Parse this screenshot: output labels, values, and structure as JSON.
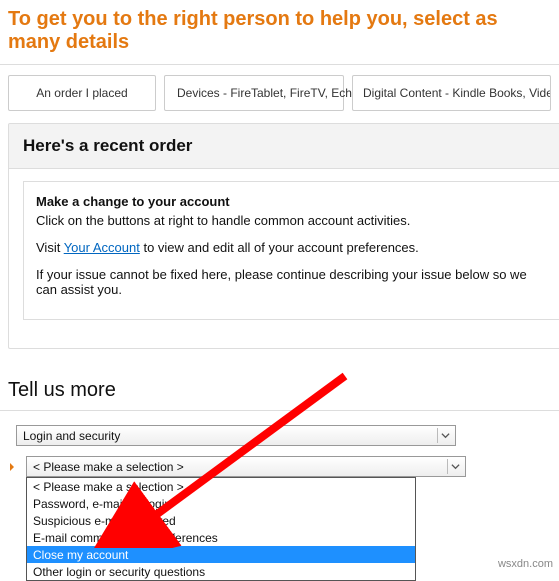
{
  "heading": "To get you to the right person to help you, select as many details",
  "tabs": [
    "An order I placed",
    "Devices - FireTablet, FireTV, Echo etc.",
    "Digital Content - Kindle Books, Videos, Music"
  ],
  "panel": {
    "title": "Here's a recent order",
    "box_title": "Make a change to your account",
    "line1": "Click on the buttons at right to handle common account activities.",
    "line2_pre": "Visit ",
    "line2_link": "Your Account",
    "line2_post": " to view and edit all of your account preferences.",
    "line3": "If your issue cannot be fixed here, please continue describing your issue below so we can assist you."
  },
  "tell_us_more": "Tell us more",
  "select1": "Login and security",
  "select2": "< Please make a selection >",
  "options": [
    "< Please make a selection >",
    "Password, e-mail, or login",
    "Suspicious e-mail received",
    "E-mail communication preferences",
    "Close my account",
    "Other login or security questions"
  ],
  "selected_index": 4,
  "watermark": "wsxdn.com",
  "colors": {
    "accent": "#e47911",
    "link": "#0066c0",
    "highlight": "#1e90ff",
    "arrow": "#ff0000"
  }
}
